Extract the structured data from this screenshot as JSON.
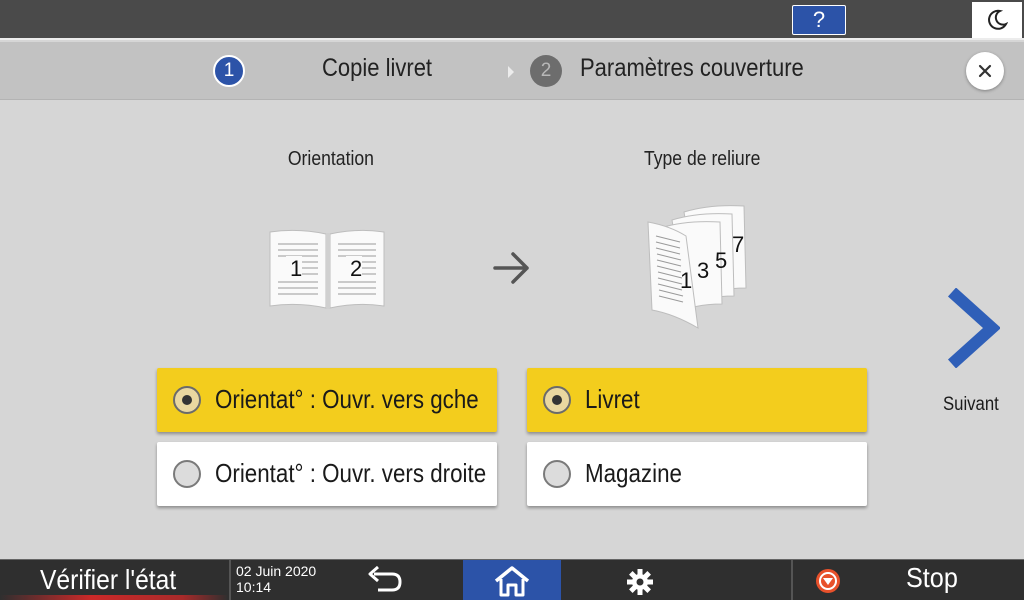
{
  "header": {
    "help_label": "?",
    "moon_icon": "moon-icon"
  },
  "steps": [
    {
      "number": "1",
      "label": "Copie livret",
      "active": true
    },
    {
      "number": "2",
      "label": "Paramètres couverture",
      "active": false
    }
  ],
  "close_icon": "close-icon",
  "orientation": {
    "title": "Orientation",
    "illustration_pages": [
      "1",
      "2"
    ],
    "options": [
      {
        "label": "Orientat° : Ouvr. vers gche",
        "selected": true
      },
      {
        "label": "Orientat° : Ouvr. vers droite",
        "selected": false
      }
    ]
  },
  "binding": {
    "title": "Type de reliure",
    "illustration_pages": [
      "1",
      "3",
      "5",
      "7"
    ],
    "options": [
      {
        "label": "Livret",
        "selected": true
      },
      {
        "label": "Magazine",
        "selected": false
      }
    ]
  },
  "next": {
    "label": "Suivant"
  },
  "footer": {
    "verify_label": "Vérifier l'état",
    "date": "02 Juin 2020",
    "time": "10:14",
    "stop_label": "Stop"
  },
  "colors": {
    "accent_blue": "#2c53a8",
    "selected_yellow": "#f3cd1d",
    "background": "#d6d6d6",
    "bar_dark": "#2f2f2f"
  }
}
